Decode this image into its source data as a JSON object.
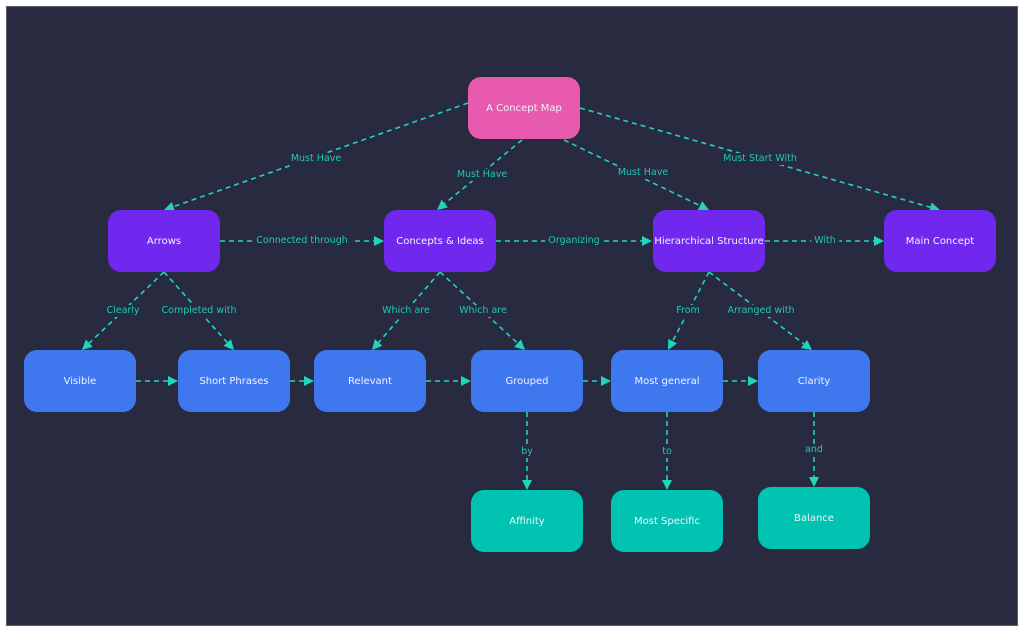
{
  "colors": {
    "background": "#282a40",
    "root": "#e75aad",
    "primary": "#7028ef",
    "secondary": "#3f78ee",
    "tertiary": "#00c4b1",
    "edge": "#1fd6bd",
    "edge_label": "#1fc9b3"
  },
  "nodes": {
    "concept_map": {
      "label": "A Concept Map",
      "level": "root"
    },
    "arrows": {
      "label": "Arrows",
      "level": "primary"
    },
    "concepts_ideas": {
      "label": "Concepts & Ideas",
      "level": "primary"
    },
    "hierarchical_structure": {
      "label": "Hierarchical Structure",
      "level": "primary"
    },
    "main_concept": {
      "label": "Main Concept",
      "level": "primary"
    },
    "visible": {
      "label": "Visible",
      "level": "secondary"
    },
    "short_phrases": {
      "label": "Short Phrases",
      "level": "secondary"
    },
    "relevant": {
      "label": "Relevant",
      "level": "secondary"
    },
    "grouped": {
      "label": "Grouped",
      "level": "secondary"
    },
    "most_general": {
      "label": "Most general",
      "level": "secondary"
    },
    "clarity": {
      "label": "Clarity",
      "level": "secondary"
    },
    "affinity": {
      "label": "Affinity",
      "level": "tertiary"
    },
    "most_specific": {
      "label": "Most Specific",
      "level": "tertiary"
    },
    "balance": {
      "label": "Balance",
      "level": "tertiary"
    }
  },
  "edges": [
    {
      "from": "concept_map",
      "to": "arrows",
      "label": "Must Have"
    },
    {
      "from": "concept_map",
      "to": "concepts_ideas",
      "label": "Must Have"
    },
    {
      "from": "concept_map",
      "to": "hierarchical_structure",
      "label": "Must Have"
    },
    {
      "from": "concept_map",
      "to": "main_concept",
      "label": "Must Start With"
    },
    {
      "from": "arrows",
      "to": "concepts_ideas",
      "label": "Connected through"
    },
    {
      "from": "concepts_ideas",
      "to": "hierarchical_structure",
      "label": "Organizing"
    },
    {
      "from": "hierarchical_structure",
      "to": "main_concept",
      "label": "With"
    },
    {
      "from": "arrows",
      "to": "visible",
      "label": "Clearly"
    },
    {
      "from": "arrows",
      "to": "short_phrases",
      "label": "Completed with"
    },
    {
      "from": "concepts_ideas",
      "to": "relevant",
      "label": "Which are"
    },
    {
      "from": "concepts_ideas",
      "to": "grouped",
      "label": "Which are"
    },
    {
      "from": "hierarchical_structure",
      "to": "most_general",
      "label": "From"
    },
    {
      "from": "hierarchical_structure",
      "to": "clarity",
      "label": "Arranged with"
    },
    {
      "from": "visible",
      "to": "short_phrases",
      "label": ""
    },
    {
      "from": "short_phrases",
      "to": "relevant",
      "label": ""
    },
    {
      "from": "relevant",
      "to": "grouped",
      "label": ""
    },
    {
      "from": "grouped",
      "to": "most_general",
      "label": ""
    },
    {
      "from": "most_general",
      "to": "clarity",
      "label": ""
    },
    {
      "from": "grouped",
      "to": "affinity",
      "label": "by"
    },
    {
      "from": "most_general",
      "to": "most_specific",
      "label": "to"
    },
    {
      "from": "clarity",
      "to": "balance",
      "label": "and"
    }
  ]
}
